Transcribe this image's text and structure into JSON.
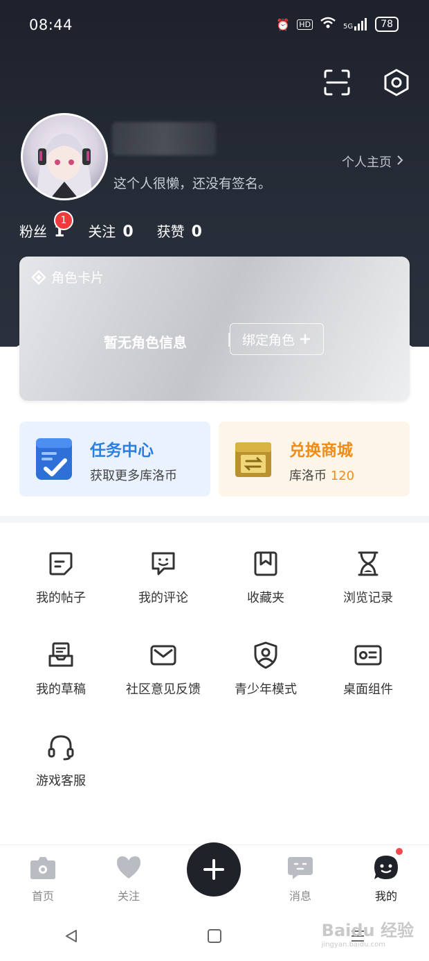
{
  "status_bar": {
    "time": "08:44",
    "battery": "78",
    "network": "5G"
  },
  "header": {
    "signature": "这个人很懒，还没有签名。",
    "homepage_link": "个人主页"
  },
  "stats": [
    {
      "label": "粉丝",
      "value": "1",
      "badge": "1"
    },
    {
      "label": "关注",
      "value": "0"
    },
    {
      "label": "获赞",
      "value": "0"
    }
  ],
  "role_card": {
    "title": "角色卡片",
    "empty_text": "暂无角色信息",
    "bind_button": "绑定角色"
  },
  "features": {
    "task": {
      "title": "任务中心",
      "subtitle": "获取更多库洛币"
    },
    "shop": {
      "title": "兑换商城",
      "subtitle_prefix": "库洛币",
      "coins": "120"
    }
  },
  "tools": [
    {
      "label": "我的帖子",
      "icon": "post-icon"
    },
    {
      "label": "我的评论",
      "icon": "comment-icon"
    },
    {
      "label": "收藏夹",
      "icon": "bookmark-icon"
    },
    {
      "label": "浏览记录",
      "icon": "hourglass-icon"
    },
    {
      "label": "我的草稿",
      "icon": "draft-icon"
    },
    {
      "label": "社区意见反馈",
      "icon": "mail-icon"
    },
    {
      "label": "青少年模式",
      "icon": "shield-user-icon"
    },
    {
      "label": "桌面组件",
      "icon": "widget-card-icon"
    },
    {
      "label": "游戏客服",
      "icon": "headset-icon"
    }
  ],
  "tabbar": [
    {
      "label": "首页",
      "icon": "home-camera-icon"
    },
    {
      "label": "关注",
      "icon": "heart-icon"
    },
    {
      "label": "",
      "icon": "plus-icon"
    },
    {
      "label": "消息",
      "icon": "message-icon"
    },
    {
      "label": "我的",
      "icon": "profile-face-icon",
      "active": true
    }
  ],
  "watermark": {
    "text": "Baidu 经验",
    "sub": "jingyan.baidu.com"
  },
  "colors": {
    "accent_blue": "#2a7fe0",
    "accent_orange": "#f08b16",
    "badge_red": "#ef3b3b"
  }
}
